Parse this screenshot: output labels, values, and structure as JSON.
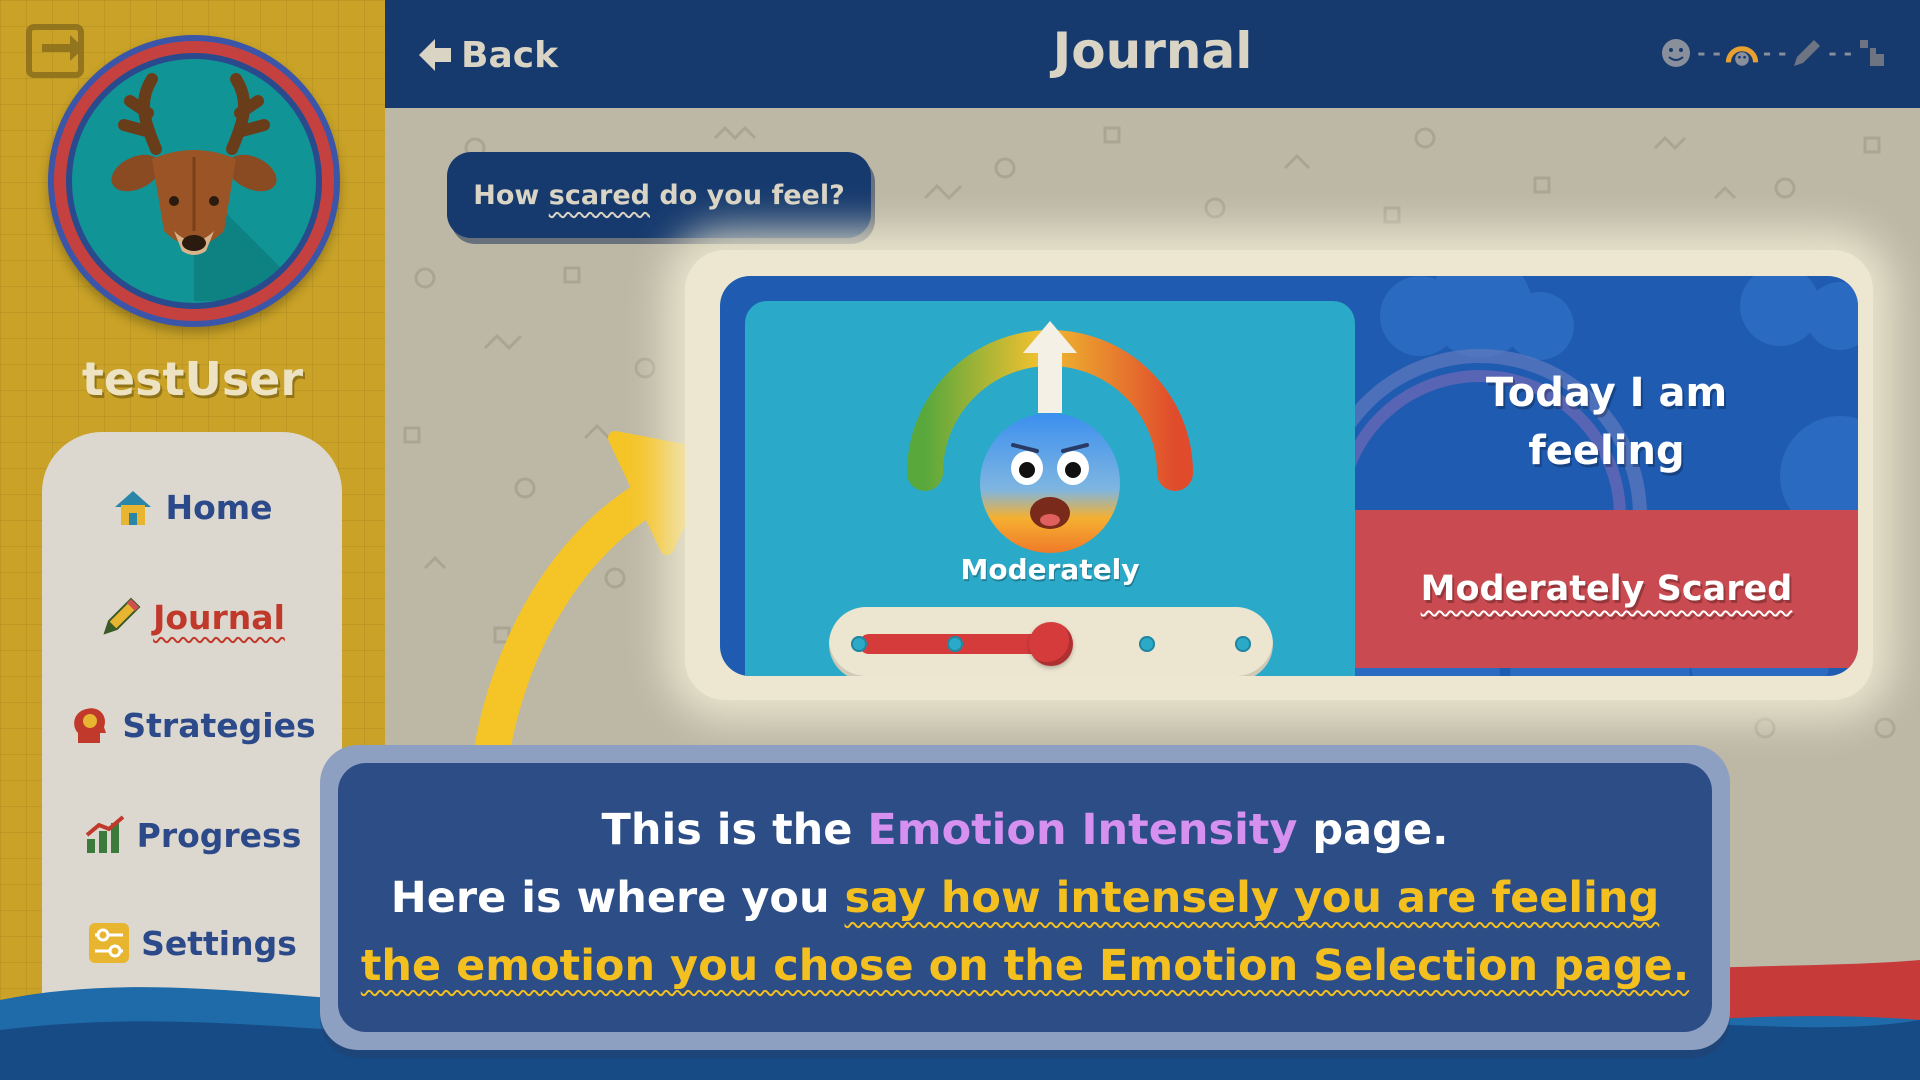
{
  "sidebar": {
    "username": "testUser",
    "nav": [
      {
        "label": "Home",
        "icon": "house-icon",
        "active": false
      },
      {
        "label": "Journal",
        "icon": "pencil-icon",
        "active": true
      },
      {
        "label": "Strategies",
        "icon": "head-icon",
        "active": false
      },
      {
        "label": "Progress",
        "icon": "bar-chart-icon",
        "active": false
      },
      {
        "label": "Settings",
        "icon": "sliders-icon",
        "active": false
      }
    ]
  },
  "header": {
    "back_label": "Back",
    "title": "Journal",
    "steps": [
      "emotion-face-icon",
      "intensity-gauge-icon",
      "pencil-icon",
      "pointer-icon"
    ]
  },
  "main": {
    "question": {
      "prefix": "How ",
      "emphasis": "scared",
      "suffix": " do you feel?"
    },
    "intensity": {
      "label": "Moderately",
      "level_index": 2,
      "level_count": 5
    },
    "feeling": {
      "heading_line1": "Today I am",
      "heading_line2": "feeling",
      "result": "Moderately Scared"
    }
  },
  "tooltip": {
    "line1_a": "This is the ",
    "line1_accent": "Emotion Intensity",
    "line1_b": " page.",
    "line2_a": "Here is where you ",
    "line2_hl": "say how intensely you are feeling",
    "line3_hl": "the emotion you chose on the Emotion Selection page."
  },
  "colors": {
    "header": "#163a6e",
    "sidebar": "#c9a227",
    "accent_red": "#c94a50",
    "highlight_yellow": "#f4c020",
    "accent_purple": "#d690f0"
  }
}
